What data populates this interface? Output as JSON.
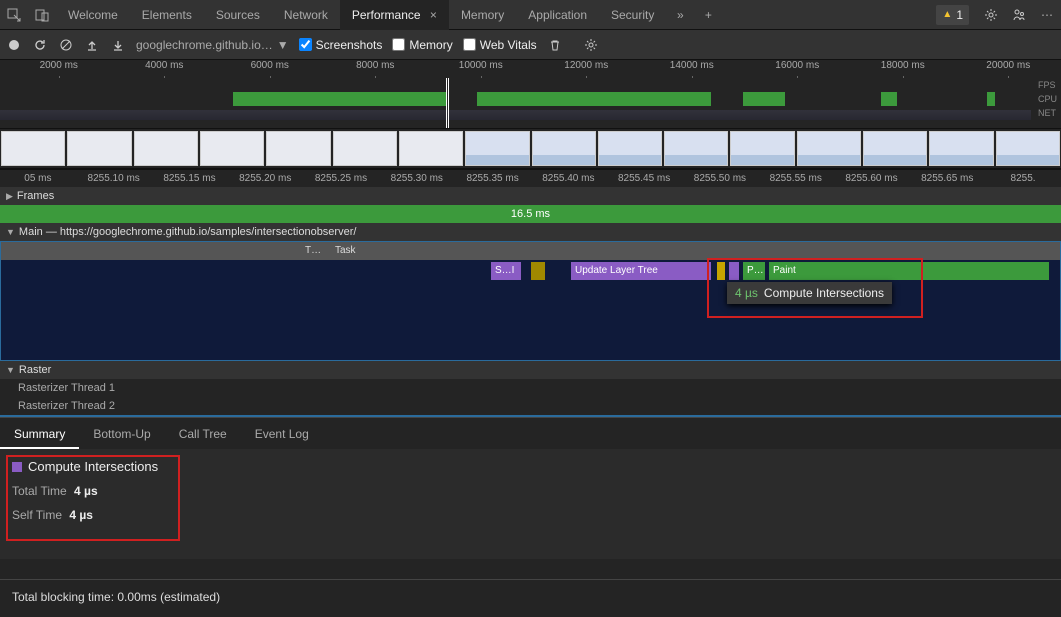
{
  "tabs": {
    "items": [
      "Welcome",
      "Elements",
      "Sources",
      "Network",
      "Performance",
      "Memory",
      "Application",
      "Security"
    ],
    "active": "Performance",
    "more": "»",
    "plus": "+"
  },
  "warning": {
    "count": "1"
  },
  "toolbar": {
    "url": "googlechrome.github.io…",
    "screenshots": "Screenshots",
    "memory": "Memory",
    "webvitals": "Web Vitals"
  },
  "overview": {
    "ticks": [
      "2000 ms",
      "4000 ms",
      "6000 ms",
      "8000 ms",
      "10000 ms",
      "12000 ms",
      "14000 ms",
      "16000 ms",
      "18000 ms",
      "20000 ms"
    ],
    "labels": [
      "FPS",
      "CPU",
      "NET"
    ]
  },
  "detailTicks": [
    "05 ms",
    "8255.10 ms",
    "8255.15 ms",
    "8255.20 ms",
    "8255.25 ms",
    "8255.30 ms",
    "8255.35 ms",
    "8255.40 ms",
    "8255.45 ms",
    "8255.50 ms",
    "8255.55 ms",
    "8255.60 ms",
    "8255.65 ms",
    "8255."
  ],
  "frames": {
    "label": "Frames",
    "duration": "16.5 ms"
  },
  "main": {
    "label": "Main — https://googlechrome.github.io/samples/intersectionobserver/",
    "task_short": "T…",
    "task": "Task",
    "si": "S…I",
    "update_layer": "Update Layer Tree",
    "paint_short": "P…",
    "paint": "Paint"
  },
  "tooltip": {
    "time": "4 µs",
    "name": "Compute Intersections"
  },
  "raster": {
    "label": "Raster",
    "rows": [
      "Rasterizer Thread 1",
      "Rasterizer Thread 2"
    ]
  },
  "detailTabs": [
    "Summary",
    "Bottom-Up",
    "Call Tree",
    "Event Log"
  ],
  "summary": {
    "title": "Compute Intersections",
    "totalLabel": "Total Time",
    "totalValue": "4 µs",
    "selfLabel": "Self Time",
    "selfValue": "4 µs"
  },
  "footer": "Total blocking time: 0.00ms (estimated)"
}
